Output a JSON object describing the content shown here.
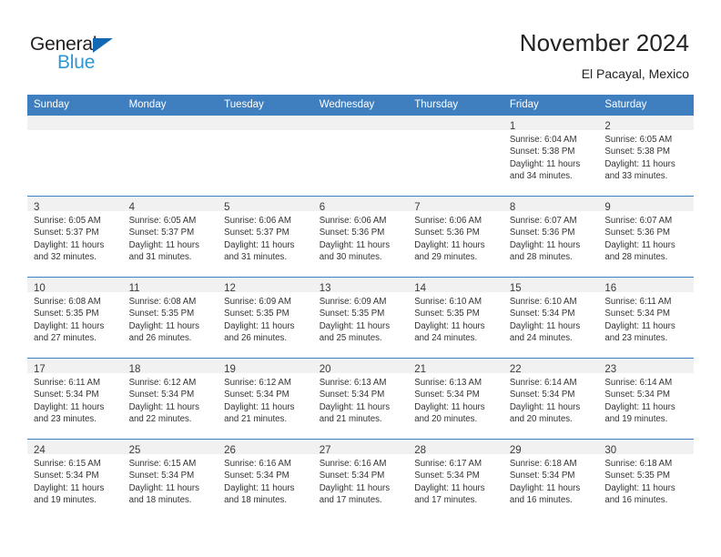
{
  "brand": {
    "name_part1": "General",
    "name_part2": "Blue",
    "accent_color": "#2e97d4",
    "triangle_color": "#1268b3"
  },
  "header": {
    "title": "November 2024",
    "subtitle": "El Pacayal, Mexico",
    "header_bg": "#3f7fbf"
  },
  "weekdays": [
    "Sunday",
    "Monday",
    "Tuesday",
    "Wednesday",
    "Thursday",
    "Friday",
    "Saturday"
  ],
  "weeks": [
    [
      {
        "day": "",
        "lines": []
      },
      {
        "day": "",
        "lines": []
      },
      {
        "day": "",
        "lines": []
      },
      {
        "day": "",
        "lines": []
      },
      {
        "day": "",
        "lines": []
      },
      {
        "day": "1",
        "lines": [
          "Sunrise: 6:04 AM",
          "Sunset: 5:38 PM",
          "Daylight: 11 hours",
          "and 34 minutes."
        ]
      },
      {
        "day": "2",
        "lines": [
          "Sunrise: 6:05 AM",
          "Sunset: 5:38 PM",
          "Daylight: 11 hours",
          "and 33 minutes."
        ]
      }
    ],
    [
      {
        "day": "3",
        "lines": [
          "Sunrise: 6:05 AM",
          "Sunset: 5:37 PM",
          "Daylight: 11 hours",
          "and 32 minutes."
        ]
      },
      {
        "day": "4",
        "lines": [
          "Sunrise: 6:05 AM",
          "Sunset: 5:37 PM",
          "Daylight: 11 hours",
          "and 31 minutes."
        ]
      },
      {
        "day": "5",
        "lines": [
          "Sunrise: 6:06 AM",
          "Sunset: 5:37 PM",
          "Daylight: 11 hours",
          "and 31 minutes."
        ]
      },
      {
        "day": "6",
        "lines": [
          "Sunrise: 6:06 AM",
          "Sunset: 5:36 PM",
          "Daylight: 11 hours",
          "and 30 minutes."
        ]
      },
      {
        "day": "7",
        "lines": [
          "Sunrise: 6:06 AM",
          "Sunset: 5:36 PM",
          "Daylight: 11 hours",
          "and 29 minutes."
        ]
      },
      {
        "day": "8",
        "lines": [
          "Sunrise: 6:07 AM",
          "Sunset: 5:36 PM",
          "Daylight: 11 hours",
          "and 28 minutes."
        ]
      },
      {
        "day": "9",
        "lines": [
          "Sunrise: 6:07 AM",
          "Sunset: 5:36 PM",
          "Daylight: 11 hours",
          "and 28 minutes."
        ]
      }
    ],
    [
      {
        "day": "10",
        "lines": [
          "Sunrise: 6:08 AM",
          "Sunset: 5:35 PM",
          "Daylight: 11 hours",
          "and 27 minutes."
        ]
      },
      {
        "day": "11",
        "lines": [
          "Sunrise: 6:08 AM",
          "Sunset: 5:35 PM",
          "Daylight: 11 hours",
          "and 26 minutes."
        ]
      },
      {
        "day": "12",
        "lines": [
          "Sunrise: 6:09 AM",
          "Sunset: 5:35 PM",
          "Daylight: 11 hours",
          "and 26 minutes."
        ]
      },
      {
        "day": "13",
        "lines": [
          "Sunrise: 6:09 AM",
          "Sunset: 5:35 PM",
          "Daylight: 11 hours",
          "and 25 minutes."
        ]
      },
      {
        "day": "14",
        "lines": [
          "Sunrise: 6:10 AM",
          "Sunset: 5:35 PM",
          "Daylight: 11 hours",
          "and 24 minutes."
        ]
      },
      {
        "day": "15",
        "lines": [
          "Sunrise: 6:10 AM",
          "Sunset: 5:34 PM",
          "Daylight: 11 hours",
          "and 24 minutes."
        ]
      },
      {
        "day": "16",
        "lines": [
          "Sunrise: 6:11 AM",
          "Sunset: 5:34 PM",
          "Daylight: 11 hours",
          "and 23 minutes."
        ]
      }
    ],
    [
      {
        "day": "17",
        "lines": [
          "Sunrise: 6:11 AM",
          "Sunset: 5:34 PM",
          "Daylight: 11 hours",
          "and 23 minutes."
        ]
      },
      {
        "day": "18",
        "lines": [
          "Sunrise: 6:12 AM",
          "Sunset: 5:34 PM",
          "Daylight: 11 hours",
          "and 22 minutes."
        ]
      },
      {
        "day": "19",
        "lines": [
          "Sunrise: 6:12 AM",
          "Sunset: 5:34 PM",
          "Daylight: 11 hours",
          "and 21 minutes."
        ]
      },
      {
        "day": "20",
        "lines": [
          "Sunrise: 6:13 AM",
          "Sunset: 5:34 PM",
          "Daylight: 11 hours",
          "and 21 minutes."
        ]
      },
      {
        "day": "21",
        "lines": [
          "Sunrise: 6:13 AM",
          "Sunset: 5:34 PM",
          "Daylight: 11 hours",
          "and 20 minutes."
        ]
      },
      {
        "day": "22",
        "lines": [
          "Sunrise: 6:14 AM",
          "Sunset: 5:34 PM",
          "Daylight: 11 hours",
          "and 20 minutes."
        ]
      },
      {
        "day": "23",
        "lines": [
          "Sunrise: 6:14 AM",
          "Sunset: 5:34 PM",
          "Daylight: 11 hours",
          "and 19 minutes."
        ]
      }
    ],
    [
      {
        "day": "24",
        "lines": [
          "Sunrise: 6:15 AM",
          "Sunset: 5:34 PM",
          "Daylight: 11 hours",
          "and 19 minutes."
        ]
      },
      {
        "day": "25",
        "lines": [
          "Sunrise: 6:15 AM",
          "Sunset: 5:34 PM",
          "Daylight: 11 hours",
          "and 18 minutes."
        ]
      },
      {
        "day": "26",
        "lines": [
          "Sunrise: 6:16 AM",
          "Sunset: 5:34 PM",
          "Daylight: 11 hours",
          "and 18 minutes."
        ]
      },
      {
        "day": "27",
        "lines": [
          "Sunrise: 6:16 AM",
          "Sunset: 5:34 PM",
          "Daylight: 11 hours",
          "and 17 minutes."
        ]
      },
      {
        "day": "28",
        "lines": [
          "Sunrise: 6:17 AM",
          "Sunset: 5:34 PM",
          "Daylight: 11 hours",
          "and 17 minutes."
        ]
      },
      {
        "day": "29",
        "lines": [
          "Sunrise: 6:18 AM",
          "Sunset: 5:34 PM",
          "Daylight: 11 hours",
          "and 16 minutes."
        ]
      },
      {
        "day": "30",
        "lines": [
          "Sunrise: 6:18 AM",
          "Sunset: 5:35 PM",
          "Daylight: 11 hours",
          "and 16 minutes."
        ]
      }
    ]
  ]
}
